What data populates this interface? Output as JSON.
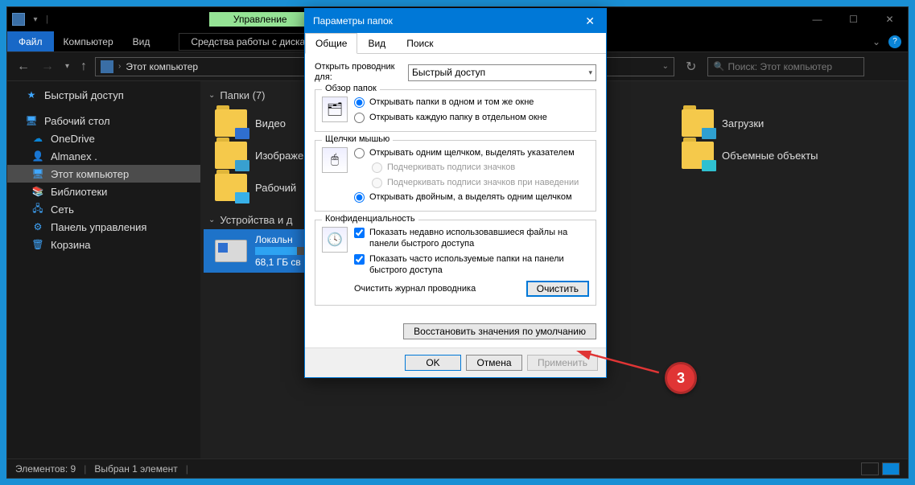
{
  "titlebar": {
    "contextual_tab": "Управление"
  },
  "window_controls": {
    "min": "—",
    "max": "☐",
    "close": "✕"
  },
  "menubar": {
    "file": "Файл",
    "computer": "Компьютер",
    "view": "Вид",
    "drive_tools": "Средства работы с дисками",
    "help_icon": "?"
  },
  "addressbar": {
    "location": "Этот компьютер"
  },
  "search": {
    "placeholder": "Поиск: Этот компьютер"
  },
  "sidebar": {
    "quick_access": "Быстрый доступ",
    "desktop": "Рабочий стол",
    "onedrive": "OneDrive",
    "user": "Almanex .",
    "this_pc": "Этот компьютер",
    "libraries": "Библиотеки",
    "network": "Сеть",
    "control_panel": "Панель управления",
    "recycle_bin": "Корзина"
  },
  "content": {
    "folders_header": "Папки (7)",
    "devices_header": "Устройства и д",
    "folders": {
      "videos": "Видео",
      "downloads": "Загрузки",
      "pictures": "Изображе",
      "objects3d": "Объемные объекты",
      "desktop": "Рабочий"
    },
    "drive": {
      "name": "Локальн",
      "free": "68,1 ГБ св"
    }
  },
  "statusbar": {
    "count": "Элементов: 9",
    "selection": "Выбран 1 элемент"
  },
  "dialog": {
    "title": "Параметры папок",
    "tabs": {
      "general": "Общие",
      "view": "Вид",
      "search": "Поиск"
    },
    "open_explorer_for": "Открыть проводник для:",
    "open_select_value": "Быстрый доступ",
    "browse_legend": "Обзор папок",
    "browse_same": "Открывать папки в одном и том же окне",
    "browse_new": "Открывать каждую папку в отдельном окне",
    "click_legend": "Щелчки мышью",
    "click_single": "Открывать одним щелчком, выделять указателем",
    "click_underline_always": "Подчеркивать подписи значков",
    "click_underline_hover": "Подчеркивать подписи значков при наведении",
    "click_double": "Открывать двойным, а выделять одним щелчком",
    "privacy_legend": "Конфиденциальность",
    "privacy_recent": "Показать недавно использовавшиеся файлы на панели быстрого доступа",
    "privacy_freq": "Показать часто используемые папки на панели быстрого доступа",
    "clear_label": "Очистить журнал проводника",
    "clear_btn": "Очистить",
    "restore_defaults": "Восстановить значения по умолчанию",
    "ok": "OK",
    "cancel": "Отмена",
    "apply": "Применить"
  },
  "annotation": {
    "number": "3"
  }
}
